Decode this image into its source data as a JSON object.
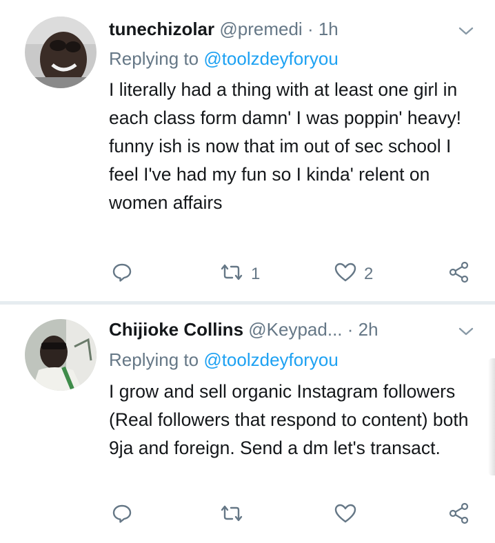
{
  "tweets": [
    {
      "name": "tunechizolar",
      "handle": "@premedi",
      "dot": "·",
      "time": "1h",
      "replying_prefix": "Replying to ",
      "replying_to": "@toolzdeyforyou",
      "body": "I literally had a thing with at least one girl in each class form damn' I was poppin' heavy! funny ish is now that im out of sec school I feel I've had my fun so I kinda' relent on women affairs",
      "retweet_count": "1",
      "like_count": "2"
    },
    {
      "name": "Chijioke Collins",
      "handle": "@Keypad...",
      "dot": "·",
      "time": "2h",
      "replying_prefix": "Replying to ",
      "replying_to": "@toolzdeyforyou",
      "body": "I grow and sell organic Instagram followers (Real followers that respond to content) both 9ja and foreign. Send a dm let's transact.",
      "retweet_count": "",
      "like_count": ""
    }
  ],
  "icons": {
    "reply": "reply-icon",
    "retweet": "retweet-icon",
    "like": "heart-icon",
    "share": "share-icon",
    "more": "chevron-down-icon"
  },
  "colors": {
    "text": "#14171a",
    "secondary": "#657786",
    "link": "#1da1f2",
    "divider": "#e6ecf0"
  }
}
